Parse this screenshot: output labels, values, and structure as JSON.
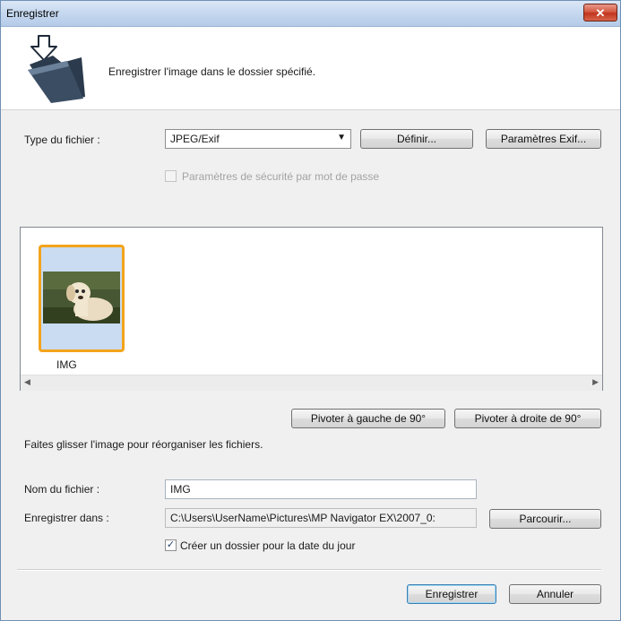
{
  "window": {
    "title": "Enregistrer",
    "close_label": "✕"
  },
  "header": {
    "description": "Enregistrer l'image dans le dossier spécifié."
  },
  "file_type": {
    "label": "Type du fichier :",
    "selected": "JPEG/Exif",
    "define_button": "Définir...",
    "exif_button": "Paramètres Exif..."
  },
  "password_security": {
    "label": "Paramètres de sécurité par mot de passe",
    "checked": false,
    "enabled": false
  },
  "thumbnails": [
    {
      "label": "IMG",
      "selected": true
    }
  ],
  "rotate": {
    "left_button": "Pivoter à gauche de 90°",
    "right_button": "Pivoter à droite de 90°"
  },
  "hint": "Faites glisser l'image pour réorganiser les fichiers.",
  "file_name": {
    "label": "Nom du fichier :",
    "value": "IMG"
  },
  "save_in": {
    "label": "Enregistrer dans :",
    "value": "C:\\Users\\UserName\\Pictures\\MP Navigator EX\\2007_0:",
    "browse_button": "Parcourir..."
  },
  "date_folder": {
    "label": "Créer un dossier pour la date du jour",
    "checked": true
  },
  "actions": {
    "save_button": "Enregistrer",
    "cancel_button": "Annuler"
  },
  "colors": {
    "title_bar": "#c3d6ee",
    "selection_border": "#f3a41c",
    "close_button": "#c1341e"
  }
}
